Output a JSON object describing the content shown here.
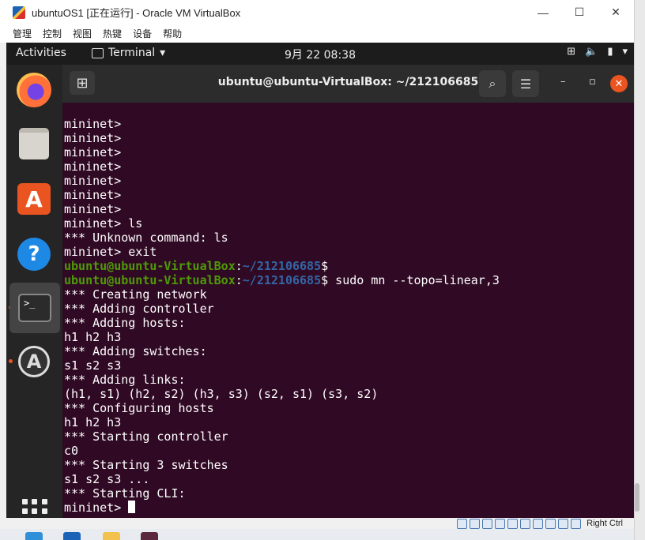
{
  "window": {
    "title": "ubuntuOS1 [正在运行] - Oracle VM VirtualBox",
    "minimize_icon": "—",
    "maximize_icon": "☐",
    "close_icon": "✕"
  },
  "menubar": {
    "items": [
      "管理",
      "控制",
      "视图",
      "热键",
      "设备",
      "帮助"
    ]
  },
  "guest_topbar": {
    "activities": "Activities",
    "app_menu": "Terminal",
    "clock": "9月 22  08:38"
  },
  "terminal": {
    "title": "ubuntu@ubuntu-VirtualBox: ~/212106685",
    "lines": [
      "mininet>",
      "mininet>",
      "mininet>",
      "mininet>",
      "mininet>",
      "mininet>",
      "mininet>",
      "mininet> ls",
      "*** Unknown command: ls",
      "mininet> exit"
    ],
    "prompt_user": "ubuntu@ubuntu-VirtualBox",
    "prompt_sep": ":",
    "prompt_path": "~/212106685",
    "prompt_end": "$",
    "command": " sudo mn --topo=linear,3",
    "output": [
      "*** Creating network",
      "*** Adding controller",
      "*** Adding hosts:",
      "h1 h2 h3",
      "*** Adding switches:",
      "s1 s2 s3",
      "*** Adding links:",
      "(h1, s1) (h2, s2) (h3, s3) (s2, s1) (s3, s2)",
      "*** Configuring hosts",
      "h1 h2 h3",
      "*** Starting controller",
      "c0",
      "*** Starting 3 switches",
      "s1 s2 s3 ...",
      "*** Starting CLI:"
    ],
    "final_prompt": "mininet> "
  },
  "status_bar": {
    "host_key": "Right Ctrl"
  }
}
